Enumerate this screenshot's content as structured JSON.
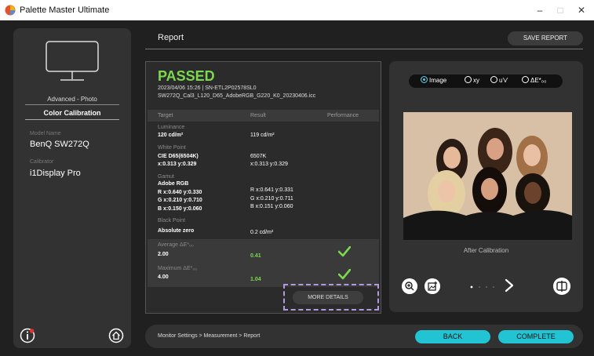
{
  "window": {
    "title": "Palette Master Ultimate",
    "min": "–",
    "max": "□",
    "close": "✕"
  },
  "sidebar": {
    "mode": "Advanced - Photo",
    "section": "Color Calibration",
    "model_label": "Model Name",
    "model_value": "BenQ SW272Q",
    "calibrator_label": "Calibrator",
    "calibrator_value": "i1Display Pro"
  },
  "header": {
    "title": "Report",
    "save_label": "SAVE REPORT"
  },
  "report": {
    "status": "PASSED",
    "date_serial": "2023/04/06 15:26 | SN-ETL2P02578SL0",
    "file": "SW272Q_Cal3_L120_D65_AdobeRGB_G220_K0_20230406.icc",
    "columns": [
      "Target",
      "Result",
      "Performance"
    ],
    "luminance": {
      "label": "Luminance",
      "target": "120 cd/m²",
      "result": "119 cd/m²"
    },
    "white_point": {
      "label": "White Point",
      "target_name": "CIE D65(6504K)",
      "target_xy": "x:0.313 y:0.329",
      "result_k": "6507K",
      "result_xy": "x:0.313 y:0.329"
    },
    "gamut": {
      "label": "Gamut",
      "target_name": "Adobe RGB",
      "target_r": "R x:0.640 y:0.330",
      "target_g": "G x:0.210 y:0.710",
      "target_b": "B x:0.150 y:0.060",
      "result_r": "R x:0.641 y:0.331",
      "result_g": "G x:0.210 y:0.711",
      "result_b": "B x:0.151 y:0.060"
    },
    "black_point": {
      "label": "Black Point",
      "target": "Absolute zero",
      "result": "0.2 cd/m²"
    },
    "avg_de": {
      "label": "Average ΔE*₀₀",
      "target": "2.00",
      "result": "0.41"
    },
    "max_de": {
      "label": "Maximum ΔE*₀₀",
      "target": "4.00",
      "result": "1.04"
    },
    "more_details_label": "MORE DETAILS"
  },
  "viewer": {
    "options": [
      "Image",
      "xy",
      "u'v'",
      "ΔE*₀₀"
    ],
    "selected": "Image",
    "caption": "After Calibration"
  },
  "footer": {
    "breadcrumb": "Monitor Settings > Measurement > Report",
    "back_label": "BACK",
    "complete_label": "COMPLETE"
  },
  "colors": {
    "accent": "#22c4d4",
    "pass": "#7bd84f",
    "highlight": "#b39ae0"
  }
}
